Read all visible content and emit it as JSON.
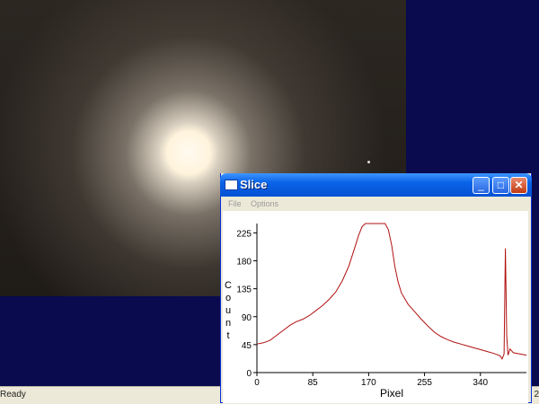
{
  "status": {
    "text": "Ready",
    "right_text": "2"
  },
  "window": {
    "title": "Slice",
    "menu": [
      "File",
      "Options"
    ],
    "buttons": {
      "minimize": "_",
      "maximize": "□",
      "close": "✕"
    }
  },
  "chart_data": {
    "type": "line",
    "xlabel": "Pixel",
    "ylabel": "Count",
    "xlim": [
      0,
      410
    ],
    "ylim": [
      0,
      240
    ],
    "x_ticks": [
      0,
      85,
      170,
      255,
      340
    ],
    "y_ticks": [
      0,
      45,
      90,
      135,
      180,
      225
    ],
    "series": [
      {
        "color": "#b01010",
        "x": [
          0,
          10,
          20,
          30,
          40,
          50,
          60,
          70,
          80,
          90,
          100,
          110,
          120,
          130,
          140,
          150,
          155,
          160,
          165,
          170,
          180,
          190,
          195,
          200,
          205,
          210,
          215,
          220,
          230,
          240,
          250,
          260,
          270,
          280,
          290,
          300,
          310,
          320,
          330,
          340,
          350,
          360,
          370,
          373,
          376,
          378,
          380,
          382,
          385,
          390,
          400,
          410
        ],
        "y": [
          46,
          48,
          52,
          60,
          68,
          76,
          82,
          86,
          92,
          100,
          108,
          118,
          130,
          148,
          172,
          205,
          222,
          235,
          240,
          240,
          240,
          240,
          240,
          230,
          205,
          170,
          145,
          128,
          110,
          98,
          86,
          75,
          65,
          58,
          53,
          49,
          46,
          43,
          40,
          37,
          34,
          31,
          27,
          22,
          30,
          200,
          60,
          28,
          38,
          32,
          30,
          28
        ]
      }
    ]
  }
}
